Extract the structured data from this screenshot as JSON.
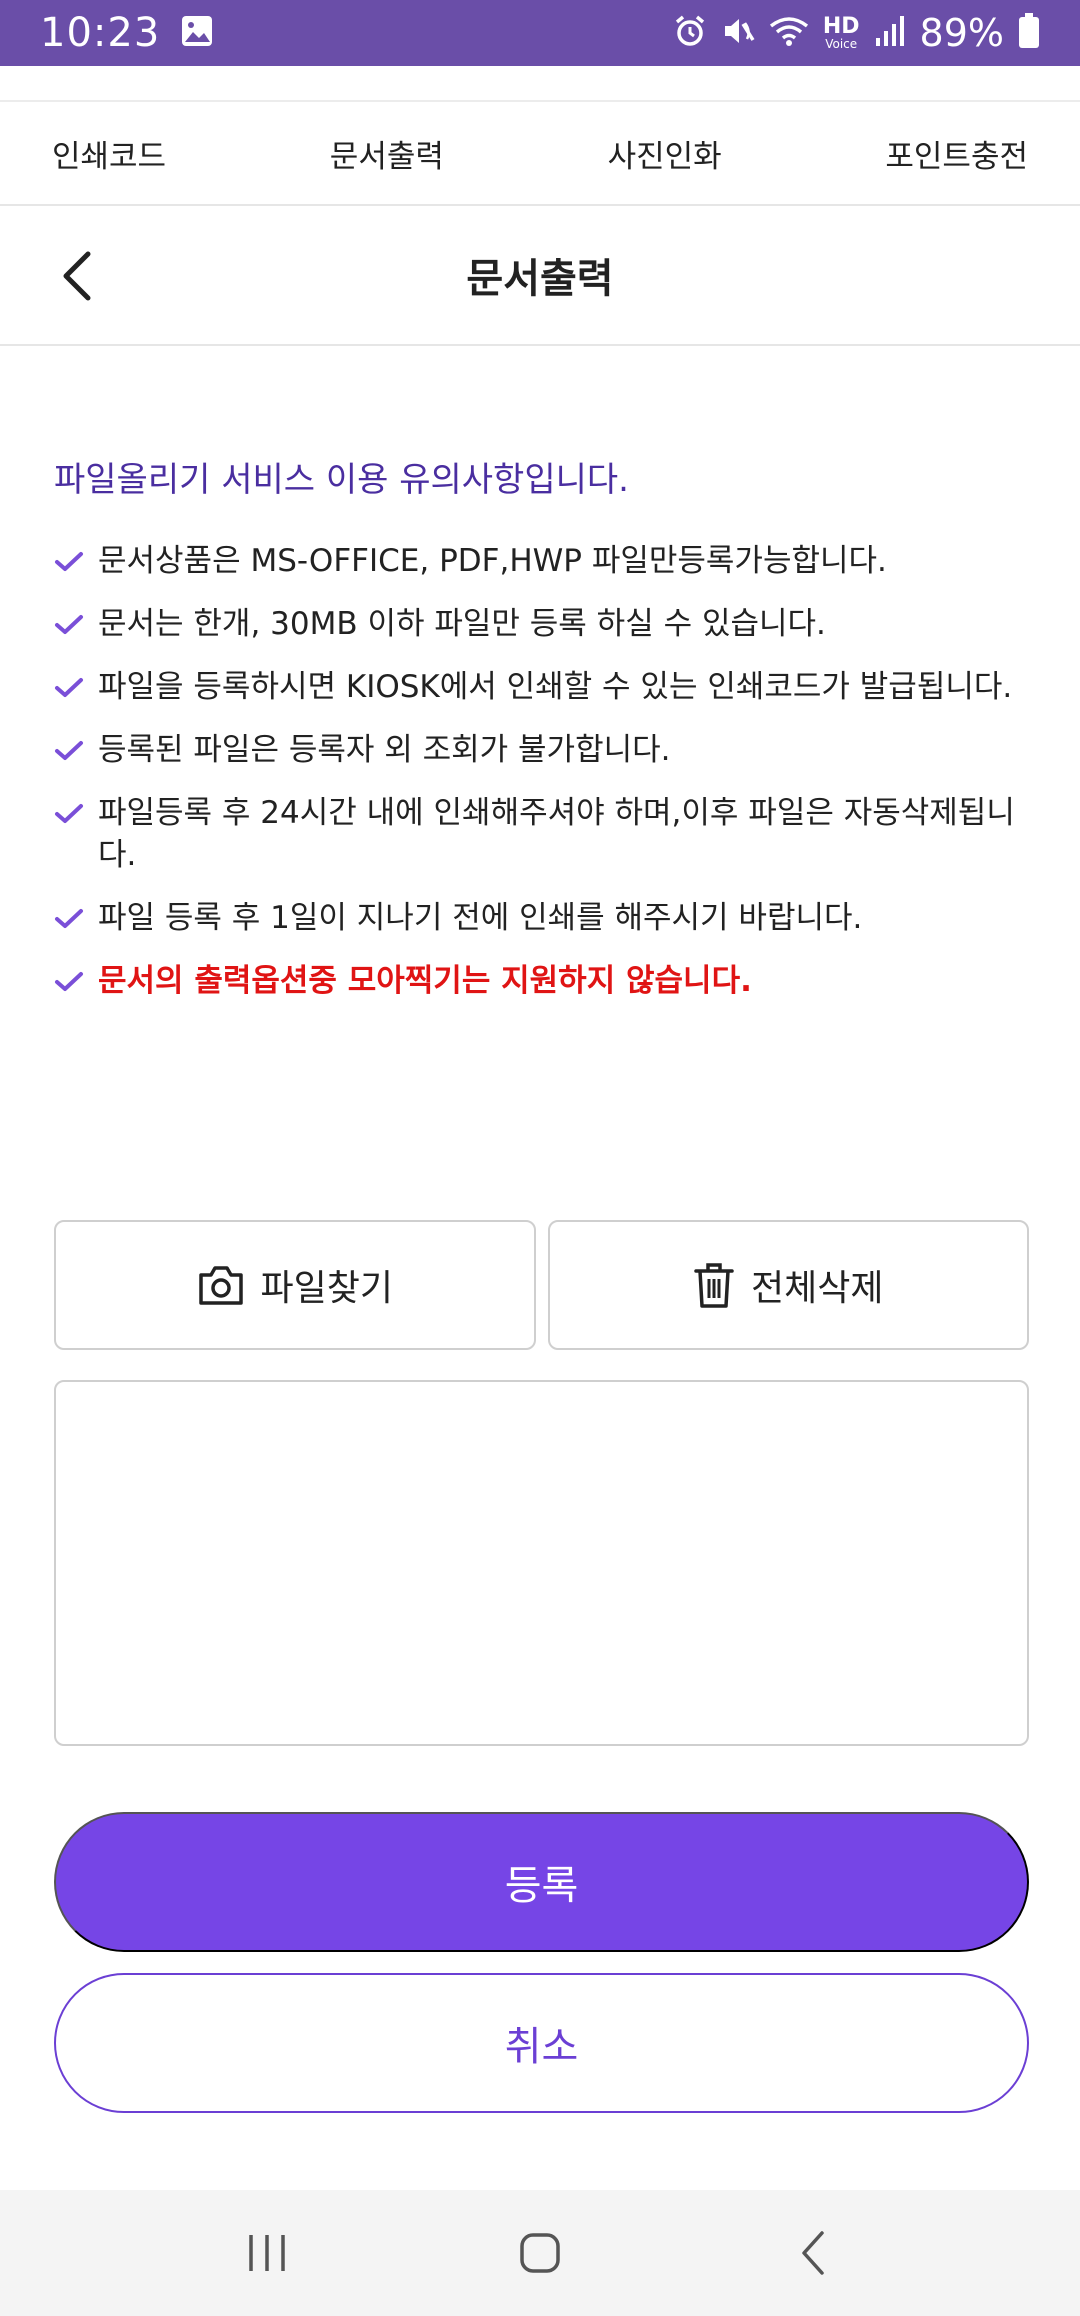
{
  "status_bar": {
    "time": "10:23",
    "battery": "89%",
    "hd": "HD",
    "voice": "Voice"
  },
  "top_nav": {
    "tabs": [
      "인쇄코드",
      "문서출력",
      "사진인화",
      "포인트충전"
    ]
  },
  "header": {
    "title": "문서출력"
  },
  "notice": {
    "title": "파일올리기 서비스 이용 유의사항입니다.",
    "items": [
      "문서상품은 MS-OFFICE, PDF,HWP 파일만등록가능합니다.",
      "문서는 한개, 30MB 이하 파일만 등록 하실 수 있습니다.",
      "파일을 등록하시면 KIOSK에서 인쇄할 수 있는 인쇄코드가 발급됩니다.",
      "등록된 파일은 등록자 외 조회가 불가합니다.",
      "파일등록 후 24시간 내에 인쇄해주셔야 하며,이후 파일은 자동삭제됩니다.",
      "파일 등록 후 1일이 지나기 전에 인쇄를 해주시기 바랍니다.",
      "문서의 출력옵션중 모아찍기는 지원하지 않습니다."
    ]
  },
  "actions": {
    "find_file": "파일찾기",
    "delete_all": "전체삭제",
    "register": "등록",
    "cancel": "취소"
  },
  "colors": {
    "status_bar": "#6a4ea8",
    "accent": "#7645e6",
    "notice_title": "#4a2ea0",
    "warning": "#e01414"
  }
}
